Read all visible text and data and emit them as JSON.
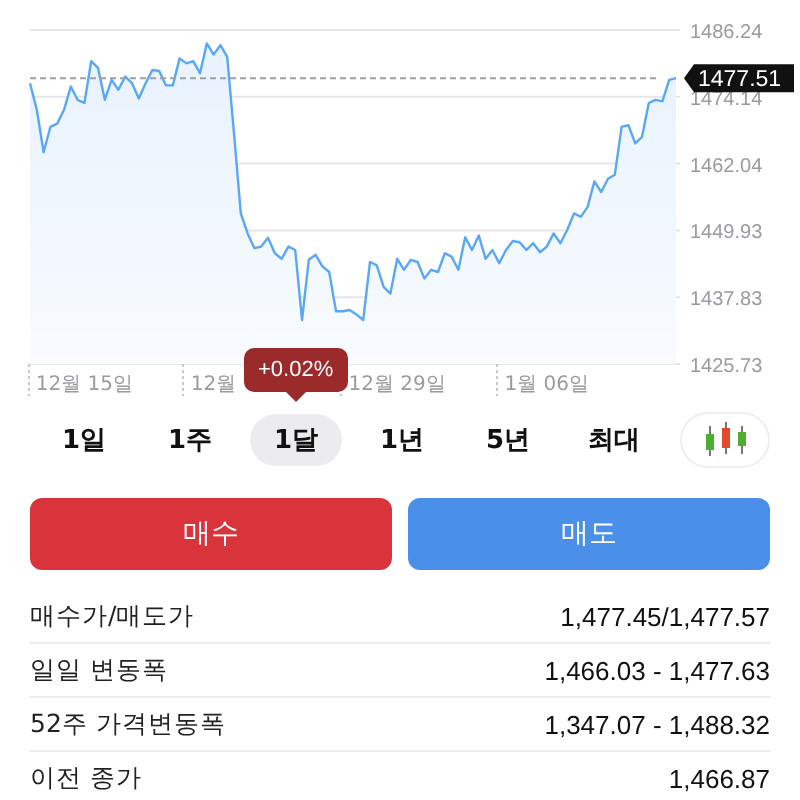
{
  "chart": {
    "chart_data": {
      "type": "area",
      "grid": true,
      "ylim": [
        1425.73,
        1486.24
      ],
      "yticks": [
        1486.24,
        1474.14,
        1462.04,
        1449.93,
        1437.83,
        1425.73
      ],
      "categories": [
        null,
        null,
        null,
        null,
        null,
        null,
        null,
        null,
        "12월 15일",
        null,
        null,
        null,
        null,
        null,
        null,
        null,
        null,
        null,
        null,
        null,
        null,
        null,
        null,
        null,
        null,
        null,
        null,
        "12월",
        null,
        null,
        null,
        null,
        null,
        null,
        null,
        null,
        null,
        null,
        null,
        null,
        null,
        null,
        null,
        null,
        null,
        null,
        null,
        null,
        null,
        null,
        null,
        null,
        null,
        null,
        "12월 29일",
        null,
        null,
        null,
        null,
        null,
        null,
        null,
        null,
        null,
        null,
        null,
        null,
        null,
        null,
        null,
        null,
        null,
        null,
        null,
        null,
        null,
        "1월 06일",
        null,
        null,
        null,
        null,
        null,
        null,
        null,
        null,
        null,
        null,
        null,
        null,
        null,
        null,
        null,
        null,
        null,
        null,
        null
      ],
      "ref_lines": [
        {
          "axis": "y",
          "value": 1477.51,
          "label": "1477.51"
        }
      ],
      "series": [
        {
          "color": "#5aa8f5",
          "values": [
            1476.6,
            1471.8,
            1464.1,
            1468.7,
            1469.3,
            1471.8,
            1476.0,
            1473.6,
            1473.0,
            1480.6,
            1479.4,
            1473.6,
            1477.2,
            1475.4,
            1477.8,
            1476.6,
            1473.8,
            1476.6,
            1479.0,
            1478.8,
            1476.2,
            1476.2,
            1481.1,
            1480.2,
            1480.6,
            1478.4,
            1483.8,
            1481.8,
            1483.5,
            1481.4,
            1467.5,
            1453.0,
            1449.4,
            1446.7,
            1447.0,
            1448.6,
            1445.8,
            1444.8,
            1447.0,
            1446.4,
            1433.7,
            1444.6,
            1445.5,
            1443.4,
            1442.4,
            1435.3,
            1435.3,
            1435.5,
            1434.7,
            1433.7,
            1444.2,
            1443.6,
            1439.7,
            1438.5,
            1444.8,
            1442.8,
            1444.6,
            1444.2,
            1441.2,
            1442.8,
            1442.4,
            1445.8,
            1445.2,
            1442.8,
            1448.7,
            1446.4,
            1449.0,
            1444.8,
            1446.4,
            1444.0,
            1446.4,
            1448.0,
            1447.8,
            1446.4,
            1447.6,
            1446.0,
            1447.0,
            1449.4,
            1447.6,
            1450.0,
            1453.0,
            1452.4,
            1454.2,
            1458.8,
            1456.9,
            1459.3,
            1460.0,
            1468.7,
            1469.0,
            1465.7,
            1466.9,
            1473.0,
            1473.6,
            1473.3,
            1477.2,
            1477.5
          ]
        }
      ]
    }
  },
  "ranges": {
    "change_badge": "+0.02%",
    "tabs": [
      {
        "label": "1일",
        "selected": false
      },
      {
        "label": "1주",
        "selected": false
      },
      {
        "label": "1달",
        "selected": true
      },
      {
        "label": "1년",
        "selected": false
      },
      {
        "label": "5년",
        "selected": false
      },
      {
        "label": "최대",
        "selected": false
      }
    ]
  },
  "actions": [
    {
      "label": "매수",
      "kind": "buy"
    },
    {
      "label": "매도",
      "kind": "sell"
    }
  ],
  "stats": [
    {
      "label": "매수가/매도가",
      "value": "1,477.45/1,477.57"
    },
    {
      "label": "일일 변동폭",
      "value": "1,466.03 - 1,477.63"
    },
    {
      "label": "52주 가격변동폭",
      "value": "1,347.07 - 1,488.32"
    },
    {
      "label": "이전 종가",
      "value": "1,466.87"
    }
  ]
}
